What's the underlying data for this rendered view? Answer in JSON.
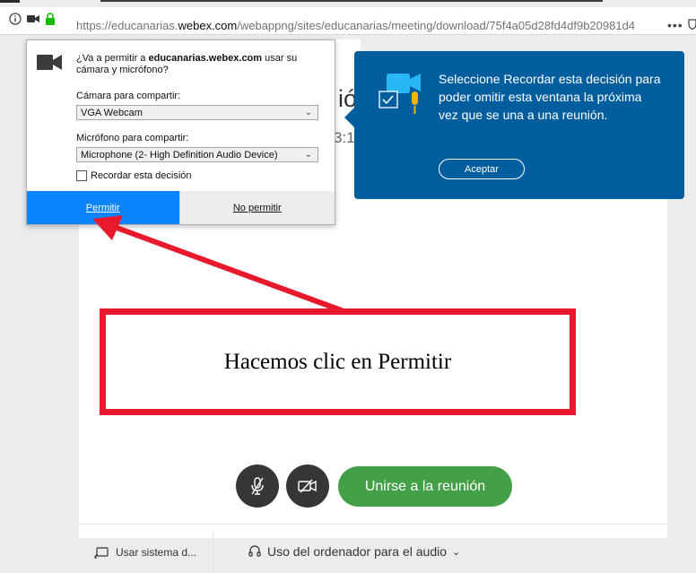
{
  "browser": {
    "url_scheme": "https://",
    "url_sub": "educanarias.",
    "url_host": "webex.com",
    "url_path": "/webappng/sites/educanarias/meeting/download/75f4a05d28fd4df9b20981d4",
    "more_label": "•••"
  },
  "permission_prompt": {
    "message_prefix": "¿Va a permitir a ",
    "message_domain": "educanarias.webex.com",
    "message_suffix": " usar su cámara y micrófono?",
    "camera_label": "Cámara para compartir:",
    "camera_value": "VGA Webcam",
    "mic_label": "Micrófono para compartir:",
    "mic_value": "Microphone (2- High Definition Audio Device)",
    "remember_label": "Recordar esta decisión",
    "allow_label": "Permitir",
    "deny_label": "No permitir",
    "allow_color": "#0a84ff"
  },
  "tooltip": {
    "text": "Seleccione Recordar esta decisión para poder omitir esta ventana la próxima vez que se una a una reunión.",
    "button_label": "Aceptar",
    "background": "#005e9f"
  },
  "page": {
    "heading_fragment": "ió",
    "time_fragment": "3:1"
  },
  "annotation": {
    "callout_text": "Hacemos clic en Permitir",
    "color": "#e8192c"
  },
  "controls": {
    "mute_icon": "microphone-muted-icon",
    "video_icon": "camera-off-icon",
    "join_label": "Unirse a la reunión",
    "join_color": "#43a047"
  },
  "footer": {
    "left_label": "Usar sistema d...",
    "audio_label": "Uso del ordenador para el audio"
  }
}
